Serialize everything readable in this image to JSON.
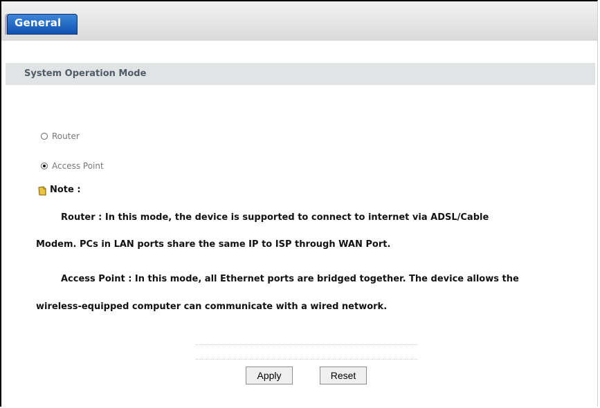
{
  "tab": {
    "label": "General"
  },
  "section": {
    "title": "System Operation Mode"
  },
  "mode": {
    "options": [
      {
        "label": "Router",
        "selected": false
      },
      {
        "label": "Access Point",
        "selected": true
      }
    ]
  },
  "note": {
    "label": "Note :",
    "router_line1": "Router : In this mode, the device is supported to connect to internet via ADSL/Cable",
    "router_line2": "Modem. PCs in LAN ports share the same IP to ISP through WAN Port.",
    "ap_line1": "Access Point : In this mode, all Ethernet ports are bridged together. The device allows the",
    "ap_line2": "wireless-equipped computer can communicate with a wired network."
  },
  "buttons": {
    "apply": "Apply",
    "reset": "Reset"
  },
  "colors": {
    "tab_blue": "#1a5fbf",
    "header_gray": "#e1e4e4",
    "section_text": "#4f5b68"
  }
}
